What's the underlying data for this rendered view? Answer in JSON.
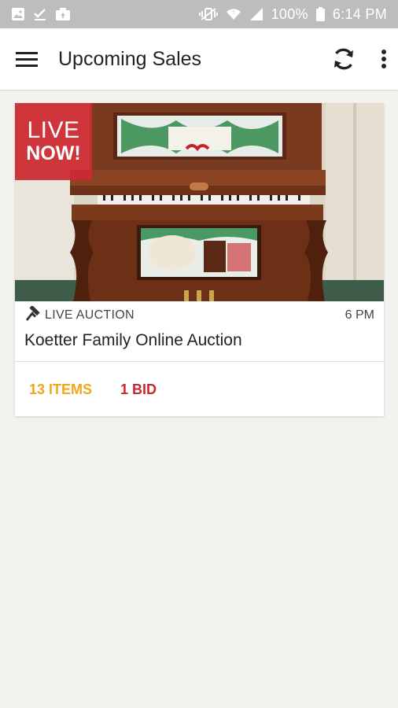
{
  "status_bar": {
    "battery_percent": "100%",
    "time": "6:14 PM",
    "icons": [
      "image-icon",
      "check-icon",
      "photo-upload-icon",
      "vibrate-icon",
      "wifi-icon",
      "signal-icon",
      "battery-icon"
    ]
  },
  "app_bar": {
    "title": "Upcoming Sales",
    "icons": [
      "menu-icon",
      "refresh-icon",
      "more-vert-icon"
    ]
  },
  "sales": [
    {
      "badge_line1": "LIVE",
      "badge_line2": "NOW!",
      "type_label": "LIVE AUCTION",
      "time": "6 PM",
      "title": "Koetter Family Online Auction",
      "items_label": "13 ITEMS",
      "bids_label": "1 BID"
    }
  ],
  "colors": {
    "status_bar_bg": "#bdbdbd",
    "app_bar_bg": "#ffffff",
    "page_bg": "#f3f2ef",
    "live_badge": "#cd2a32",
    "items_accent": "#f2a719",
    "bids_accent": "#c9272f"
  }
}
